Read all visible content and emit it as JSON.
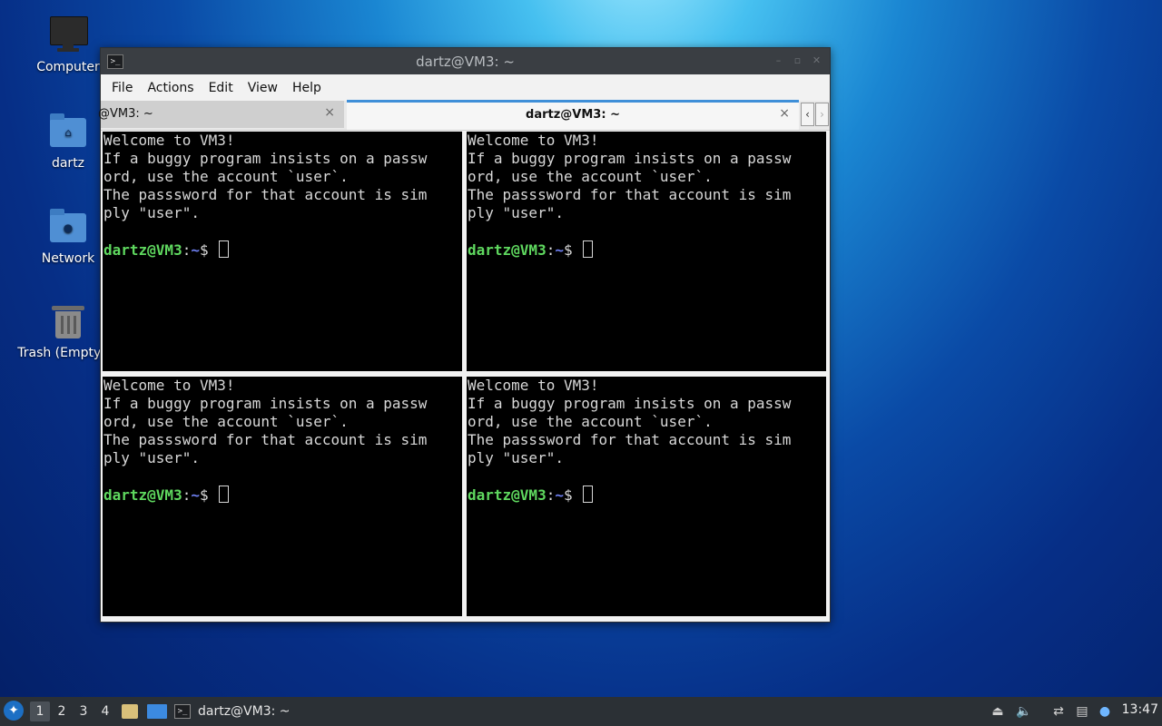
{
  "desktop": {
    "icons": [
      {
        "label": "Computer",
        "icon": "computer-icon"
      },
      {
        "label": "dartz",
        "icon": "home-folder-icon"
      },
      {
        "label": "Network",
        "icon": "network-folder-icon"
      },
      {
        "label": "Trash (Empty)",
        "icon": "trash-icon"
      }
    ]
  },
  "window": {
    "title": "dartz@VM3: ~",
    "menu": [
      "File",
      "Actions",
      "Edit",
      "View",
      "Help"
    ],
    "tabs": [
      {
        "label": "@VM3: ~",
        "close": "×"
      },
      {
        "label": "dartz@VM3: ~",
        "close": "×"
      }
    ],
    "tab_nav": {
      "prev": "‹",
      "next": "›"
    },
    "terminal": {
      "lines": [
        "Welcome to VM3!",
        "If a buggy program insists on a passw",
        "ord, use the account `user`.",
        "The passsword for that account is sim",
        "ply \"user\"."
      ],
      "prompt_user": "dartz@VM3",
      "prompt_sep": ":",
      "prompt_path": "~",
      "prompt_sign": "$ "
    }
  },
  "taskbar": {
    "workspaces": [
      "1",
      "2",
      "3",
      "4"
    ],
    "active_workspace": "1",
    "task_label": "dartz@VM3: ~",
    "clock": "13:47"
  },
  "colors": {
    "prompt_user": "#5fd85f",
    "prompt_path": "#6d7ff0",
    "tab_accent": "#3f8fd8"
  }
}
